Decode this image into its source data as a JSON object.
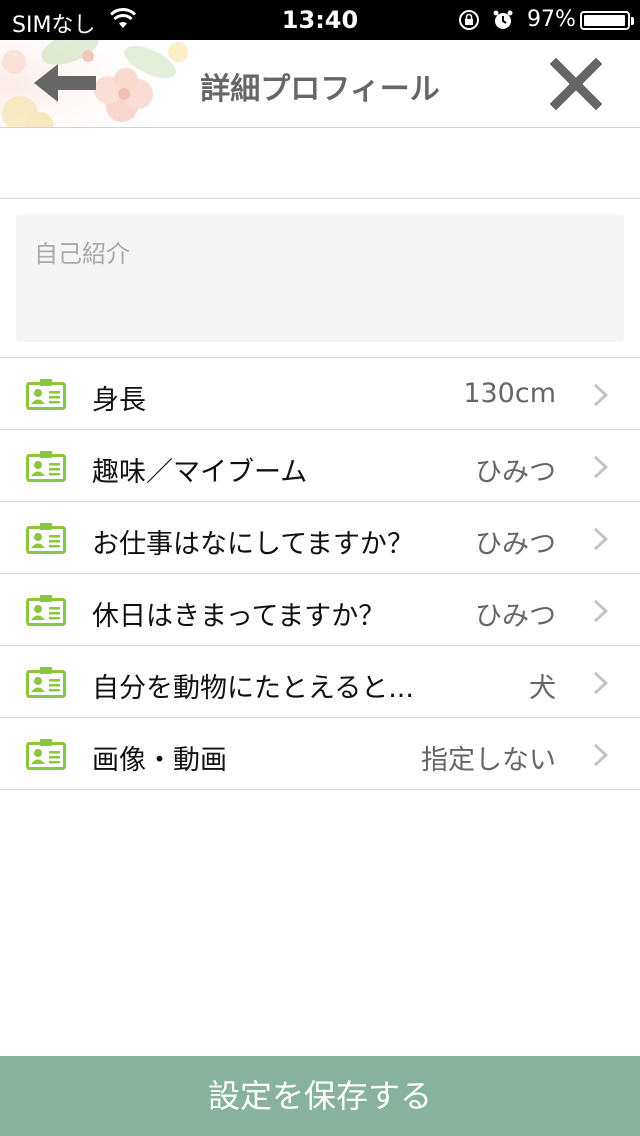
{
  "status_bar": {
    "carrier": "SIMなし",
    "time": "13:40",
    "battery_percent": "97%",
    "battery_level": 0.97
  },
  "header": {
    "title": "詳細プロフィール",
    "back_icon": "arrow-left-icon",
    "close_icon": "close-icon"
  },
  "intro": {
    "placeholder": "自己紹介"
  },
  "items": [
    {
      "label": "身長",
      "value": "130cm"
    },
    {
      "label": "趣味／マイブーム",
      "value": "ひみつ"
    },
    {
      "label": "お仕事はなにしてますか？",
      "value": "ひみつ"
    },
    {
      "label": "休日はきまってますか？",
      "value": "ひみつ"
    },
    {
      "label": "自分を動物にたとえると...",
      "value": "犬"
    },
    {
      "label": "画像・動画",
      "value": "指定しない"
    }
  ],
  "save_button": {
    "label": "設定を保存する"
  },
  "colors": {
    "accent_green": "#8cc63f",
    "save_bg": "#86b29e",
    "header_icon": "#666666"
  }
}
